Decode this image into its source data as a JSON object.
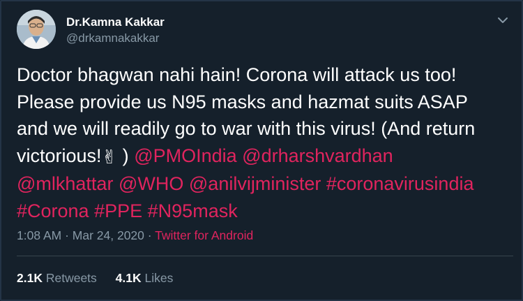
{
  "user": {
    "display_name": "Dr.Kamna Kakkar",
    "handle": "@drkamnakakkar"
  },
  "tweet": {
    "text_line1": "Doctor bhagwan nahi hain! Corona will attack us too!",
    "text_line2": "Please provide us N95 masks and hazmat suits ASAP",
    "text_line3": "and we will readily go to war with this virus! (And return",
    "text_line4_prefix": "victorious!",
    "emoji": "✌",
    "text_line4_suffix": " )",
    "mentions": [
      "@PMOIndia",
      "@drharshvardhan",
      "@mlkhattar",
      "@WHO",
      "@anilvijminister"
    ],
    "hashtags": [
      "#coronavirusindia",
      "#Corona",
      "#PPE",
      "#N95mask"
    ]
  },
  "meta": {
    "time": "1:08 AM",
    "separator": " · ",
    "date": "Mar 24, 2020",
    "source": "Twitter for Android"
  },
  "stats": {
    "retweets_count": "2.1K",
    "retweets_label": "Retweets",
    "likes_count": "4.1K",
    "likes_label": "Likes"
  },
  "colors": {
    "background": "#15202b",
    "link": "#e0245e",
    "secondary_text": "#8899a6"
  },
  "icons": [
    "avatar-photo",
    "chevron-down-icon",
    "victory-hand-emoji"
  ]
}
